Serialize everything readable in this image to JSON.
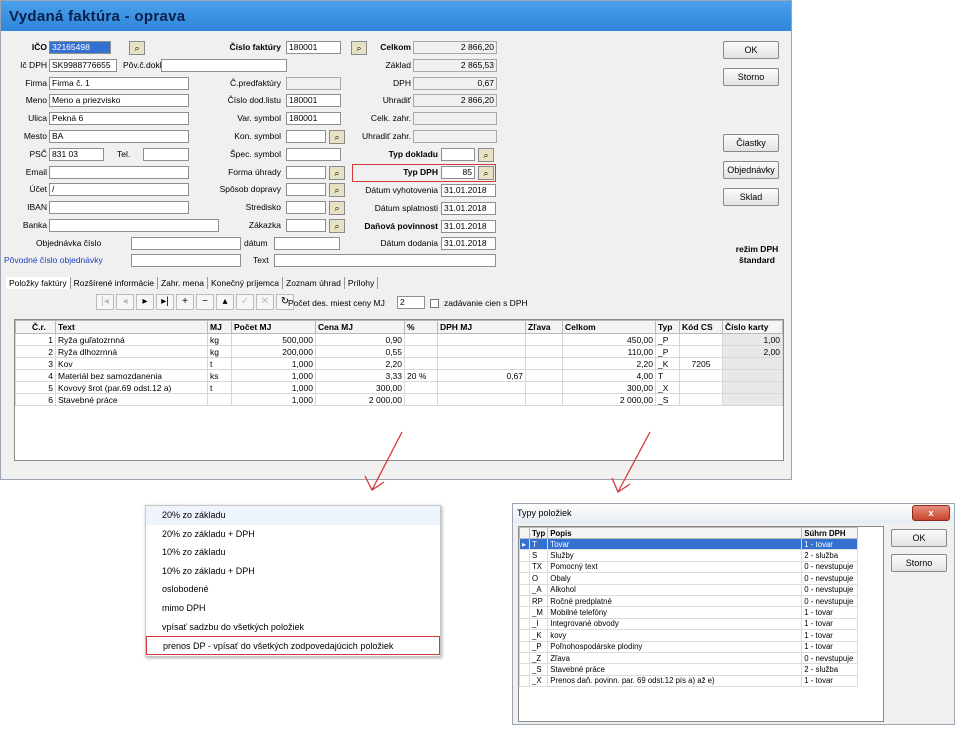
{
  "title": "Vydaná faktúra  -  oprava",
  "left_fields": [
    {
      "label": "IČO",
      "value": "32165498",
      "highlight": true
    },
    {
      "label": "Ič DPH",
      "value": "SK9988776655",
      "extra_label": "Pôv.č.dokl.",
      "extra_value": ""
    },
    {
      "label": "Firma",
      "value": "Firma č. 1"
    },
    {
      "label": "Meno",
      "value": "Meno a priezvisko"
    },
    {
      "label": "Ulica",
      "value": "Pekná 6"
    },
    {
      "label": "Mesto",
      "value": "BA"
    },
    {
      "label": "PSČ",
      "value": "831 03",
      "extra_label": "Tel.",
      "extra_value": ""
    },
    {
      "label": "Email",
      "value": ""
    },
    {
      "label": "Účet",
      "value": "/"
    },
    {
      "label": "IBAN",
      "value": ""
    },
    {
      "label": "Banka",
      "value": ""
    }
  ],
  "mid_fields": [
    {
      "label": "Číslo faktúry",
      "value": "180001"
    },
    {
      "label": "Č.predfaktúry",
      "value": ""
    },
    {
      "label": "Číslo dod.listu",
      "value": "180001"
    },
    {
      "label": "Var. symbol",
      "value": "180001"
    },
    {
      "label": "Kon. symbol",
      "value": ""
    },
    {
      "label": "Špec. symbol",
      "value": ""
    },
    {
      "label": "Forma úhrady",
      "value": ""
    },
    {
      "label": "Spôsob dopravy",
      "value": ""
    },
    {
      "label": "Stredisko",
      "value": ""
    },
    {
      "label": "Zákazka",
      "value": ""
    }
  ],
  "sum_fields": [
    {
      "label": "Celkom",
      "value": "2 866,20"
    },
    {
      "label": "Základ",
      "value": "2 865,53"
    },
    {
      "label": "DPH",
      "value": "0,67"
    },
    {
      "label": "Uhradiť",
      "value": "2 866,20"
    },
    {
      "label": "Celk. zahr.",
      "value": ""
    },
    {
      "label": "Uhradiť zahr.",
      "value": ""
    }
  ],
  "typ_dokladu": {
    "label": "Typ dokladu",
    "value": ""
  },
  "typ_dph": {
    "label": "Typ DPH",
    "value": "85"
  },
  "dates": [
    {
      "label": "Dátum vyhotovenia",
      "value": "31.01.2018"
    },
    {
      "label": "Dátum splatnosti",
      "value": "31.01.2018"
    },
    {
      "label": "Daňová povinnost",
      "value": "31.01.2018"
    },
    {
      "label": "Dátum dodania",
      "value": "31.01.2018"
    }
  ],
  "order": {
    "label": "Objednávka číslo",
    "date_label": "dátum",
    "text_label": "Text",
    "orig_label": "Pôvodné číslo objednávky"
  },
  "buttons": {
    "ok": "OK",
    "storno": "Storno",
    "ciastky": "Čiastky",
    "objednavky": "Objednávky",
    "sklad": "Sklad"
  },
  "rezim": {
    "line1": "režim DPH",
    "line2": "štandard"
  },
  "tabs": [
    "Položky faktúry",
    "Rozšírené informácie",
    "Zahr. mena",
    "Konečný príjemca",
    "Zoznam úhrad",
    "Prílohy"
  ],
  "toolbar": {
    "decimals_label": "Počet des. miest ceny MJ",
    "decimals_value": "2",
    "checkbox_label": "zadávanie cien s DPH"
  },
  "grid": {
    "headers": [
      "Č.r.",
      "Text",
      "MJ",
      "Počet MJ",
      "Cena MJ",
      "%",
      "DPH MJ",
      "Zľava",
      "Celkom",
      "Typ",
      "Kód CS",
      "Číslo karty"
    ],
    "rows": [
      [
        "1",
        "Ryža guľatozrnná",
        "kg",
        "500,000",
        "0,90",
        "",
        "",
        "",
        "450,00",
        "_P",
        "",
        "1,00"
      ],
      [
        "2",
        "Ryža dlhozrnná",
        "kg",
        "200,000",
        "0,55",
        "",
        "",
        "",
        "110,00",
        "_P",
        "",
        "2,00"
      ],
      [
        "3",
        "Kov",
        "t",
        "1,000",
        "2,20",
        "",
        "",
        "",
        "2,20",
        "_K",
        "7205",
        ""
      ],
      [
        "4",
        "Materiál bez samozdanenia",
        "ks",
        "1,000",
        "3,33",
        "20 %",
        "0,67",
        "",
        "4,00",
        "T",
        "",
        ""
      ],
      [
        "5",
        "Kovový šrot (par.69 odst.12 a)",
        "t",
        "1,000",
        "300,00",
        "",
        "",
        "",
        "300,00",
        "_X",
        "",
        ""
      ],
      [
        "6",
        "Stavebné práce",
        "",
        "1,000",
        "2 000,00",
        "",
        "",
        "",
        "2 000,00",
        "_S",
        "",
        ""
      ]
    ]
  },
  "vat_menu": [
    "20% zo základu",
    "20% zo základu + DPH",
    "10% zo základu",
    "10% zo základu + DPH",
    "oslobodené",
    "mimo DPH",
    "vpísať sadzbu do všetkých položiek",
    "prenos DP - vpísať do všetkých zodpovedajúcich položiek"
  ],
  "types_dialog": {
    "title": "Typy položiek",
    "close": "x",
    "ok": "OK",
    "storno": "Storno",
    "headers": [
      "Typ",
      "Popis",
      "Súhrn DPH"
    ],
    "rows": [
      [
        "T",
        "Tovar",
        "1 - tovar"
      ],
      [
        "S",
        "Služby",
        "2 - služba"
      ],
      [
        "TX",
        "Pomocný text",
        "0 - nevstupuje"
      ],
      [
        "O",
        "Obaly",
        "0 - nevstupuje"
      ],
      [
        "_A",
        "Alkohol",
        "0 - nevstupuje"
      ],
      [
        "RP",
        "Ročné predplatné",
        "0 - nevstupuje"
      ],
      [
        "_M",
        "Mobilné telefóny",
        "1 - tovar"
      ],
      [
        "_I",
        "Integrované obvody",
        "1 - tovar"
      ],
      [
        "_K",
        "kovy",
        "1 - tovar"
      ],
      [
        "_P",
        "Poľnohospodárske plodiny",
        "1 - tovar"
      ],
      [
        "_Z",
        "Zľava",
        "0 - nevstupuje"
      ],
      [
        "_S",
        "Stavebné práce",
        "2 - služba"
      ],
      [
        "_X",
        "Prenos daň. povinn. par. 69 odst.12 pís a) až e)",
        "1 - tovar"
      ]
    ]
  },
  "colors": {
    "title_bg": "#2f86db",
    "accent_red": "#d23b3b",
    "selection": "#3370d0"
  }
}
